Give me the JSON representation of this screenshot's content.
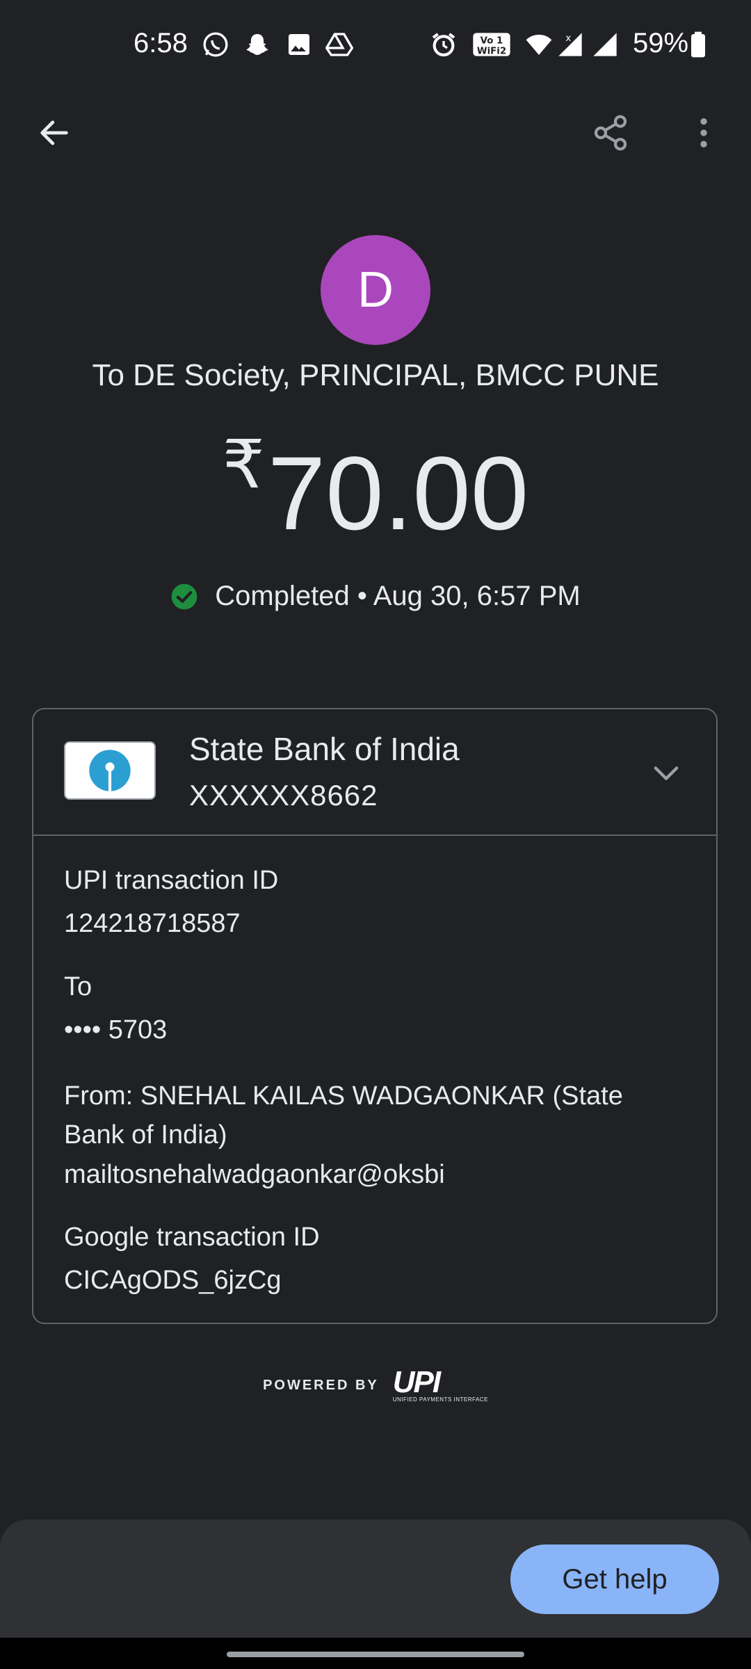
{
  "status_bar": {
    "time": "6:58",
    "battery": "59%",
    "icons": [
      "whatsapp-icon",
      "snapchat-icon",
      "gallery-icon",
      "drive-icon",
      "alarm-icon",
      "vowifi-icon",
      "wifi-icon",
      "signal-icon",
      "signal-icon",
      "battery-icon"
    ]
  },
  "appbar": {
    "back_icon": "back-arrow-icon",
    "share_icon": "share-icon",
    "more_icon": "more-vert-icon"
  },
  "payee": {
    "avatar_letter": "D",
    "avatar_color": "#ab47bc",
    "title": "To DE Society, PRINCIPAL, BMCC PUNE"
  },
  "amount": {
    "currency": "₹",
    "value": "70.00"
  },
  "status": {
    "icon": "check-circle-icon",
    "text": "Completed • Aug 30, 6:57 PM",
    "color": "#1e8e3e"
  },
  "bank": {
    "name": "State Bank of India",
    "account": "XXXXXX8662",
    "chevron_icon": "chevron-down-icon"
  },
  "details": {
    "upi_label": "UPI transaction ID",
    "upi_value": "124218718587",
    "to_label": "To",
    "to_value": "•••• 5703",
    "from_text": "From: SNEHAL KAILAS WADGAONKAR (State Bank of India)",
    "from_email": "mailtosnehalwadgaonkar@oksbi",
    "google_label": "Google transaction ID",
    "google_value": "CICAgODS_6jzCg"
  },
  "footer": {
    "powered_by": "POWERED BY",
    "upi_mark": "UPI",
    "upi_sub": "UNIFIED PAYMENTS INTERFACE"
  },
  "bottom": {
    "help_label": "Get help",
    "help_color": "#8ab4f8"
  }
}
